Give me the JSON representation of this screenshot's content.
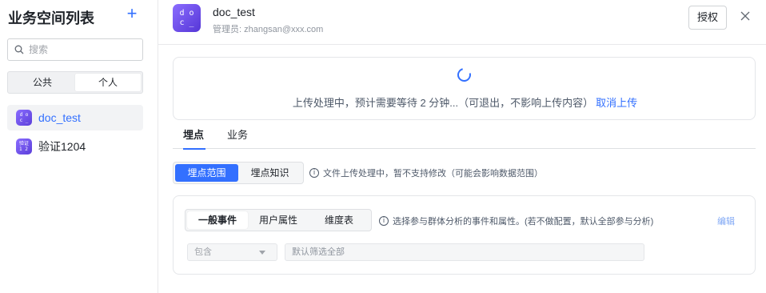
{
  "sidebar": {
    "title": "业务空间列表",
    "add_icon": "plus-icon",
    "search_placeholder": "搜索",
    "scope_tabs": [
      {
        "label": "公共",
        "active": false
      },
      {
        "label": "个人",
        "active": true
      }
    ],
    "spaces": [
      {
        "name": "doc_test",
        "avatar_text": "d o\nc _",
        "selected": true
      },
      {
        "name": "验证1204",
        "avatar_text": "验证\n1 2",
        "selected": false
      }
    ]
  },
  "header": {
    "logo_text": "d o\nc _",
    "title": "doc_test",
    "admin_line": "管理员: zhangsan@xxx.com",
    "auth_button": "授权",
    "close_icon": "close-icon"
  },
  "upload": {
    "message": "上传处理中，预计需要等待 2 分钟...（可退出，不影响上传内容）",
    "cancel_link": "取消上传",
    "accent": "#3370ff"
  },
  "main_tabs": [
    {
      "label": "埋点",
      "active": true
    },
    {
      "label": "业务",
      "active": false
    }
  ],
  "tracking_tabs": [
    {
      "label": "埋点范围",
      "active": true
    },
    {
      "label": "埋点知识",
      "active": false
    }
  ],
  "tracking_hint": "文件上传处理中，暂不支持修改（可能会影响数据范围）",
  "event_section": {
    "tabs": [
      {
        "label": "一般事件",
        "active": true
      },
      {
        "label": "用户属性",
        "active": false
      },
      {
        "label": "维度表",
        "active": false
      }
    ],
    "hint": "选择参与群体分析的事件和属性。(若不做配置，默认全部参与分析)",
    "edit_link": "编辑",
    "include_select": "包含",
    "filter_placeholder": "默认筛选全部"
  }
}
